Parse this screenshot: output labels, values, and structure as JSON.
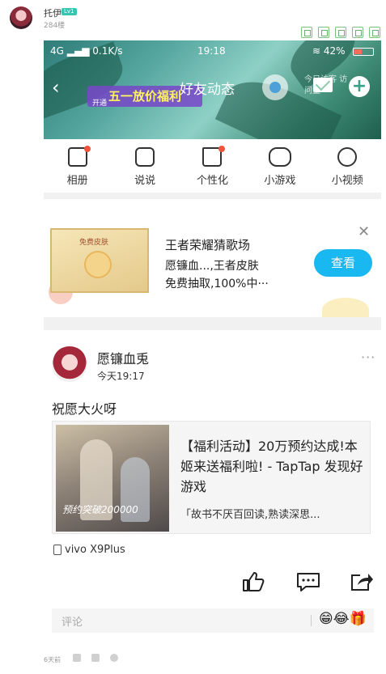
{
  "forum": {
    "poster_name": "托伊",
    "level": "Lv1",
    "floor": "284楼",
    "footer_time": "6天前"
  },
  "phone_status": {
    "network": "4G",
    "speed": "0.1K/s",
    "time": "19:18",
    "battery": "42%",
    "battery_level": 0.42
  },
  "banner": {
    "title": "好友动态",
    "promo": "五一放价福利",
    "promo_tag": "开通",
    "visitor_text": "今日访客 访问量"
  },
  "shortcuts": [
    {
      "label": "相册",
      "icon": "photo-album-icon",
      "badge": true
    },
    {
      "label": "说说",
      "icon": "chat-bubble-icon",
      "badge": false
    },
    {
      "label": "个性化",
      "icon": "tshirt-icon",
      "badge": true
    },
    {
      "label": "小游戏",
      "icon": "gamepad-icon",
      "badge": false
    },
    {
      "label": "小视频",
      "icon": "play-circle-icon",
      "badge": false
    }
  ],
  "ad": {
    "image_label": "免费皮肤",
    "title": "王者荣耀猜歌场",
    "desc_line1": "愿镰血...,王者皮肤",
    "desc_line2": "免费抽取,100%中···",
    "button": "查看",
    "close": "✕"
  },
  "post": {
    "author": "愿镰血兎",
    "time": "今天19:17",
    "more": "···",
    "text": "祝愿大火呀",
    "share_title": "【福利活动】20万预约达成!本姬来送福利啦! - TapTap 发现好游戏",
    "share_sub": "「故书不厌百回读,熟读深思...",
    "share_badge": "预约突破200000",
    "device": "vivo X9Plus",
    "comment_placeholder": "评论",
    "emoji": "😁😂🎁"
  },
  "colors": {
    "accent": "#1ab8f0",
    "badge_red": "#f0553c",
    "level_badge": "#35c6b3"
  }
}
